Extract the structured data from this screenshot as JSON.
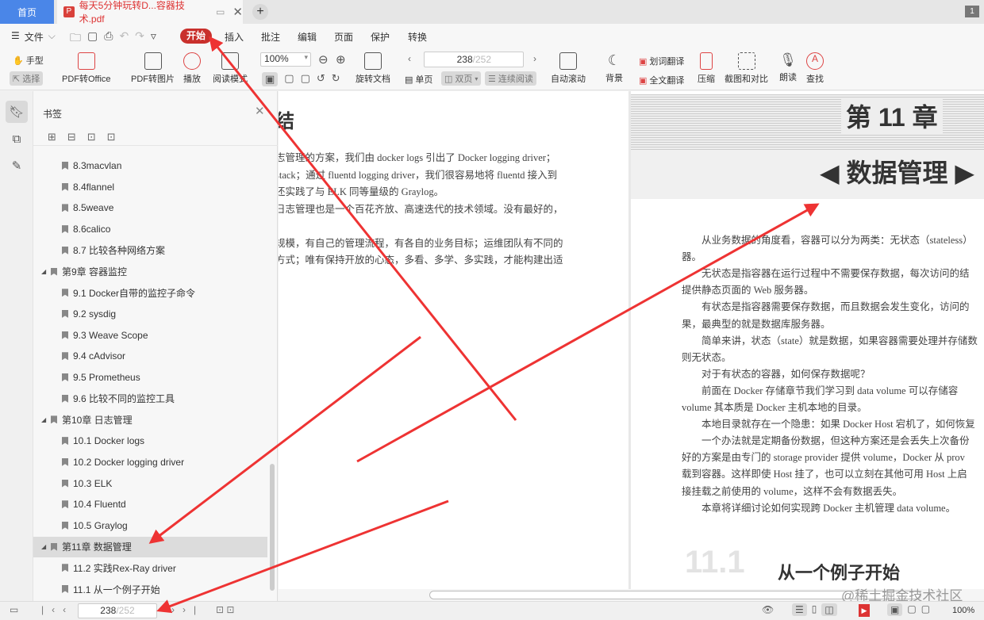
{
  "tabs": {
    "home": "首页",
    "doc": "每天5分钟玩转D...容器技术.pdf",
    "window_count": "1"
  },
  "menu": {
    "file": "文件",
    "items": [
      "开始",
      "插入",
      "批注",
      "编辑",
      "页面",
      "保护",
      "转换"
    ]
  },
  "toolbar": {
    "hand": "手型",
    "select": "选择",
    "pdf_to_office": "PDF转Office",
    "pdf_to_image": "PDF转图片",
    "play": "播放",
    "read_mode": "阅读模式",
    "zoom": "100%",
    "rotate": "旋转文档",
    "page_current": "238",
    "page_total": "/252",
    "single": "单页",
    "double": "双页",
    "continuous": "连续阅读",
    "auto_scroll": "自动滚动",
    "background": "背景",
    "word_translate": "划词翻译",
    "full_translate": "全文翻译",
    "compress": "压缩",
    "screenshot": "截图和对比",
    "read_aloud": "朗读",
    "find": "查找"
  },
  "bookmarks": {
    "title": "书签",
    "items": [
      {
        "label": "8.3macvlan",
        "level": 2
      },
      {
        "label": "8.4flannel",
        "level": 2
      },
      {
        "label": "8.5weave",
        "level": 2
      },
      {
        "label": "8.6calico",
        "level": 2
      },
      {
        "label": "8.7 比较各种网络方案",
        "level": 2
      },
      {
        "label": "第9章 容器监控",
        "level": 1
      },
      {
        "label": "9.1 Docker自带的监控子命令",
        "level": 2
      },
      {
        "label": "9.2 sysdig",
        "level": 2
      },
      {
        "label": "9.3 Weave Scope",
        "level": 2
      },
      {
        "label": "9.4 cAdvisor",
        "level": 2
      },
      {
        "label": "9.5 Prometheus",
        "level": 2
      },
      {
        "label": "9.6 比较不同的监控工具",
        "level": 2
      },
      {
        "label": "第10章 日志管理",
        "level": 1
      },
      {
        "label": "10.1 Docker logs",
        "level": 2
      },
      {
        "label": "10.2 Docker logging driver",
        "level": 2
      },
      {
        "label": "10.3 ELK",
        "level": 2
      },
      {
        "label": "10.4 Fluentd",
        "level": 2
      },
      {
        "label": "10.5 Graylog",
        "level": 2
      },
      {
        "label": "第11章 数据管理",
        "level": 1,
        "active": true
      },
      {
        "label": "11.2 实践Rex-Ray driver",
        "level": 2
      },
      {
        "label": "11.1 从一个例子开始",
        "level": 2
      }
    ]
  },
  "left_page": {
    "heading": "结",
    "lines": [
      "志管理的方案，我们由 docker logs 引出了 Docker logging driver；",
      " stack；通过 fluentd logging driver，我们很容易地将 fluentd 接入到",
      "还实践了与 ELK 同等量级的 Graylog。",
      "日志管理也是一个百花齐放、高速迭代的技术领域。没有最好的，",
      "",
      "规模，有自己的管理流程，有各自的业务目标；运维团队有不同的",
      "方式；唯有保持开放的心态，多看、多学、多实践，才能构建出适"
    ]
  },
  "right_page": {
    "chapter": "第 11 章",
    "title": "◀ 数据管理 ▶",
    "lines": [
      "　　从业务数据的角度看，容器可以分为两类：无状态（stateless）",
      "器。",
      "　　无状态是指容器在运行过程中不需要保存数据，每次访问的结",
      "提供静态页面的 Web 服务器。",
      "　　有状态是指容器需要保存数据，而且数据会发生变化，访问的",
      "果，最典型的就是数据库服务器。",
      "　　简单来讲，状态（state）就是数据，如果容器需要处理并存储数",
      "则无状态。",
      "　　对于有状态的容器，如何保存数据呢？",
      "　　前面在 Docker 存储章节我们学习到 data volume 可以存储容",
      "volume 其本质是 Docker 主机本地的目录。",
      "　　本地目录就存在一个隐患：如果 Docker Host 宕机了，如何恢复",
      "　　一个办法就是定期备份数据，但这种方案还是会丢失上次备份",
      "好的方案是由专门的 storage provider 提供 volume，Docker 从 prov",
      "载到容器。这样即使 Host 挂了，也可以立刻在其他可用 Host 上启",
      "接挂载之前使用的 volume，这样不会有数据丢失。",
      "　　本章将详细讨论如何实现跨 Docker 主机管理 data volume。"
    ],
    "section_num": "11.1",
    "section_title": "从一个例子开始"
  },
  "status": {
    "page_current": "238",
    "page_total": "/252",
    "zoom": "100%",
    "watermark": "@稀土掘金技术社区"
  },
  "colors": {
    "accent": "#c9302c",
    "arrow": "#ee3333",
    "home_tab": "#4a86e8"
  }
}
